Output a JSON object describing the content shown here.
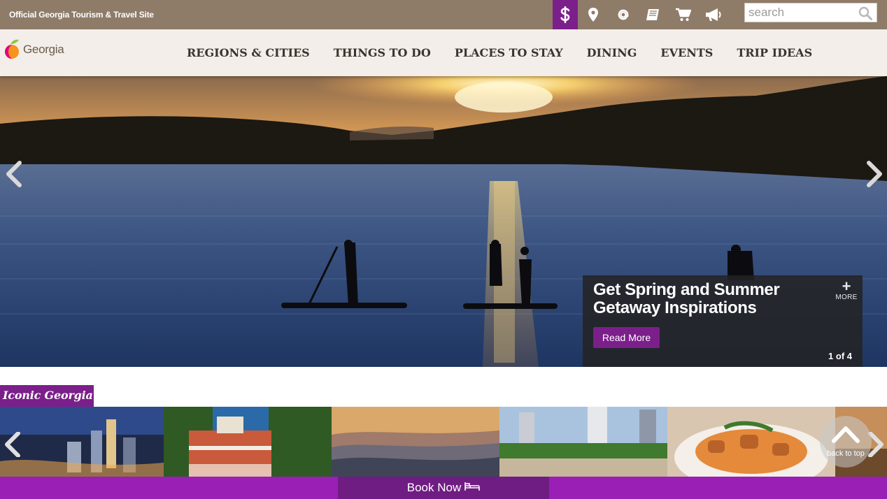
{
  "top_bar": {
    "site_tagline": "Official Georgia Tourism & Travel Site",
    "utility_icons": [
      "dollar-icon",
      "map-pin-icon",
      "at-sign-icon",
      "guide-book-icon",
      "cart-icon",
      "megaphone-icon"
    ],
    "search_placeholder": "search"
  },
  "logo": {
    "text": "Georgia"
  },
  "nav": {
    "items": [
      {
        "label": "REGIONS & CITIES"
      },
      {
        "label": "THINGS TO DO"
      },
      {
        "label": "PLACES TO STAY"
      },
      {
        "label": "DINING"
      },
      {
        "label": "EVENTS"
      },
      {
        "label": "TRIP IDEAS"
      }
    ]
  },
  "hero": {
    "title": "Get Spring and Summer Getaway Inspirations",
    "more_label": "MORE",
    "read_more_label": "Read More",
    "counter": "1 of 4"
  },
  "iconic": {
    "section_label": "Iconic Georgia",
    "back_to_top_label": "back to top"
  },
  "bottom_bar": {
    "book_now_label": "Book Now"
  },
  "colors": {
    "top_bar": "#8e7c69",
    "nav_bg": "#f3eee9",
    "purple_accent": "#7b1f8a",
    "bottom_bar": "#9a1fb5",
    "book_now_bg": "#6f1d82"
  }
}
